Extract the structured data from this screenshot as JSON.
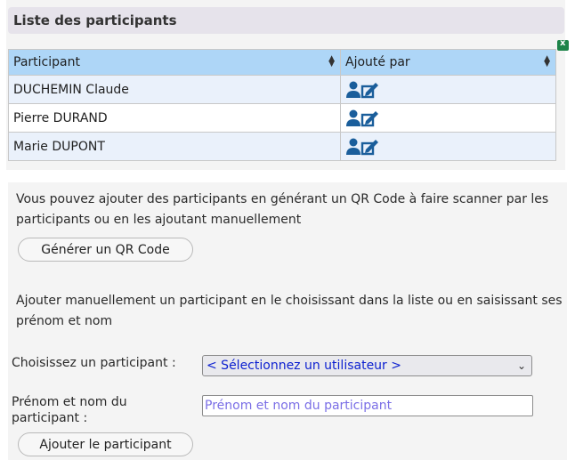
{
  "title": "Liste des participants",
  "table": {
    "headers": [
      "Participant",
      "Ajouté par"
    ],
    "rows": [
      {
        "name": "DUCHEMIN Claude"
      },
      {
        "name": "Pierre DURAND"
      },
      {
        "name": "Marie DUPONT"
      }
    ]
  },
  "qr": {
    "text": "Vous pouvez ajouter des participants en générant un QR Code à faire scanner par les participants ou en les ajoutant manuellement",
    "button": "Générer un QR Code"
  },
  "manual": {
    "text": "Ajouter manuellement un participant en le choisissant dans la liste ou en saisissant ses prénom et nom",
    "choose_label": "Choisissez un participant :",
    "select_value": "< Sélectionnez un utilisateur >",
    "name_label": "Prénom et nom du participant :",
    "name_placeholder": "Prénom et nom du participant",
    "name_value": "",
    "add_button": "Ajouter le participant"
  },
  "colors": {
    "header_bg": "#aed6f7",
    "icon_blue": "#1a5e9b",
    "link_blue": "#0b1fd0"
  },
  "icons": {
    "export": "excel-export-icon",
    "added_by": "user-edit-icon"
  }
}
